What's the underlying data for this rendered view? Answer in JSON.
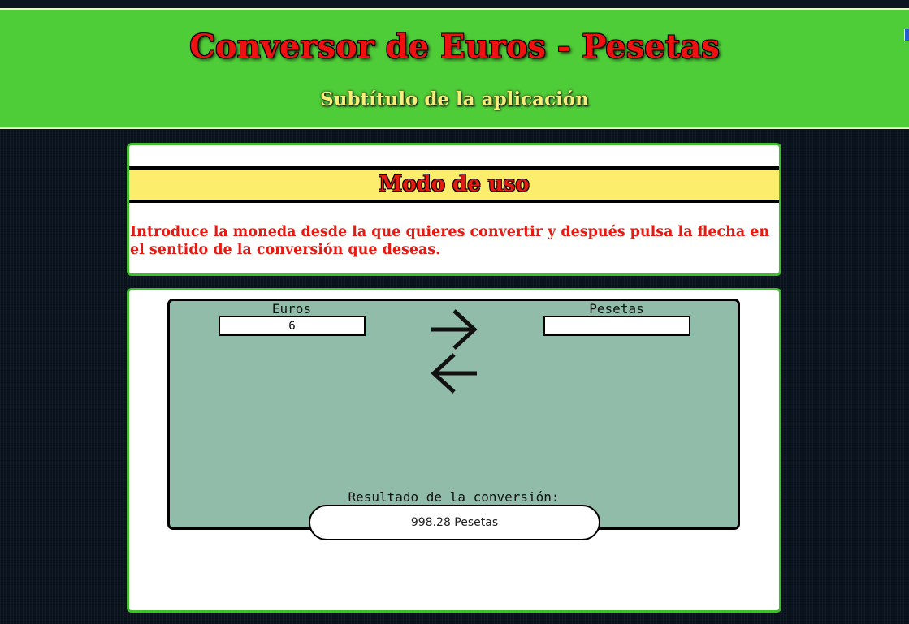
{
  "header": {
    "title": "Conversor de Euros - Pesetas",
    "subtitle": "Subtítulo de la aplicación"
  },
  "usage": {
    "heading": "Modo de uso",
    "instructions": "Introduce la moneda desde la que quieres convertir y después pulsa la flecha en el sentido de la conversión que deseas."
  },
  "converter": {
    "euros_label": "Euros",
    "euros_value": "6",
    "pesetas_label": "Pesetas",
    "pesetas_value": "",
    "arrow_right_icon": "arrow-right-icon",
    "arrow_left_icon": "arrow-left-icon",
    "result_label": "Resultado de la conversión:",
    "result_value": "998.28 Pesetas"
  },
  "colors": {
    "header_green": "#4fcd38",
    "title_red": "#ee1111",
    "subtitle_yellow": "#f5ef7a",
    "heading_yellow": "#fcee6c",
    "panel_border_green": "#3fbf2d",
    "converter_bg": "#92bcaa"
  }
}
